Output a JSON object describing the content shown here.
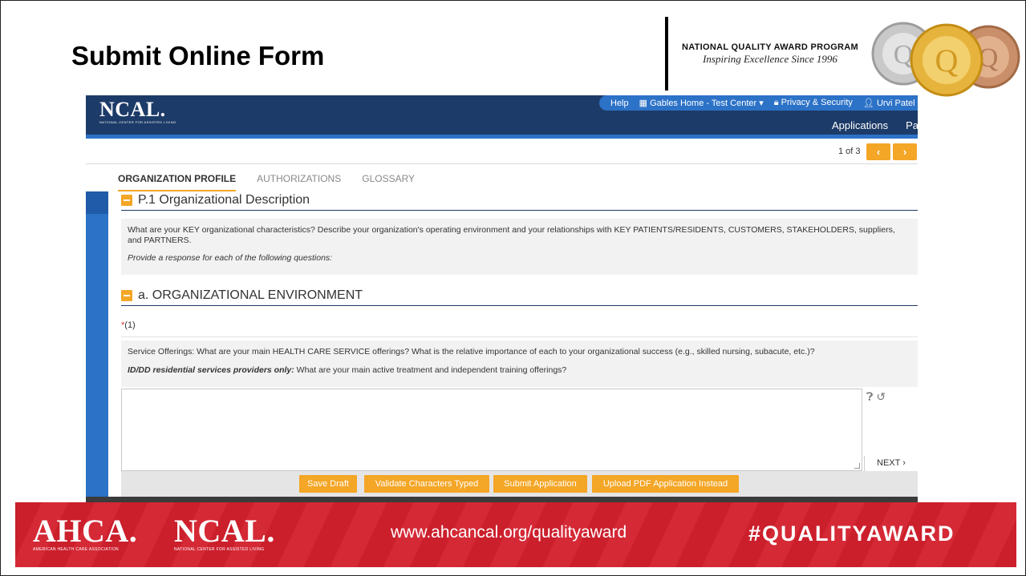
{
  "slide": {
    "title": "Submit Online Form",
    "nqa_title": "NATIONAL QUALITY AWARD PROGRAM",
    "nqa_tagline": "Inspiring Excellence Since 1996"
  },
  "app": {
    "logo": {
      "name": "NCAL.",
      "subtitle": "NATIONAL CENTER FOR ASSISTED LIVING"
    },
    "topbar": {
      "help": "Help",
      "center": "Gables Home - Test Center ▾",
      "privacy": "Privacy & Security",
      "user": "Urvi Patel ▾"
    },
    "mainnav": {
      "applications": "Applications",
      "payments": "Paym"
    },
    "pager": {
      "text": "1 of 3",
      "prev": "‹",
      "next": "›"
    },
    "tabs": [
      {
        "label": "ORGANIZATION PROFILE",
        "active": true
      },
      {
        "label": "AUTHORIZATIONS",
        "active": false
      },
      {
        "label": "GLOSSARY",
        "active": false
      }
    ],
    "section": {
      "title": "P.1 Organizational Description",
      "intro": "What are your KEY organizational characteristics? Describe your organization's operating environment and your relationships with KEY PATIENTS/RESIDENTS, CUSTOMERS, STAKEHOLDERS, suppliers, and PARTNERS.",
      "instruction": "Provide a response for each of the following questions:"
    },
    "subsection": {
      "title": "a. ORGANIZATIONAL ENVIRONMENT"
    },
    "question": {
      "required_mark": "*",
      "number": "(1)",
      "text": "Service Offerings: What are your main HEALTH CARE SERVICE offerings? What is the relative importance of each to your organizational success (e.g., skilled nursing, subacute, etc.)?",
      "note_bold": "ID/DD residential services providers only:",
      "note_text": " What are your main active treatment and independent training offerings?",
      "answer": ""
    },
    "next_label": "NEXT ›",
    "actions": {
      "save": "Save Draft",
      "validate": "Validate Characters Typed",
      "submit": "Submit Application",
      "upload": "Upload PDF Application Instead"
    }
  },
  "footer": {
    "ahca": {
      "name": "AHCA.",
      "subtitle": "AMERICAN HEALTH CARE ASSOCIATION"
    },
    "ncal": {
      "name": "NCAL.",
      "subtitle": "NATIONAL CENTER FOR ASSISTED LIVING"
    },
    "url": "www.ahcancal.org/qualityaward",
    "hashtag": "#QUALITYAWARD"
  },
  "colors": {
    "navy": "#1d3b68",
    "blue": "#2c72c7",
    "orange": "#f4a626",
    "red": "#d3202e"
  }
}
